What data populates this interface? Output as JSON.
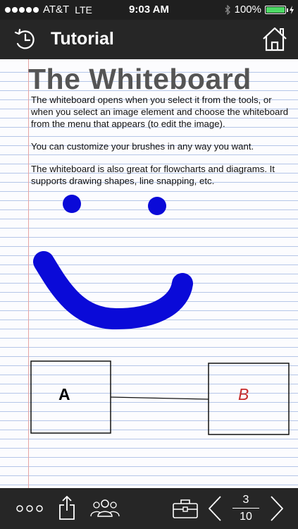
{
  "status_bar": {
    "carrier": "AT&T",
    "network": "LTE",
    "time": "9:03 AM",
    "battery": "100%",
    "battery_level": 1.0,
    "signal_dots": 5
  },
  "nav": {
    "title": "Tutorial",
    "history_icon": "history-icon",
    "home_icon": "home-icon"
  },
  "content": {
    "heading": "The Whiteboard",
    "paragraphs": [
      "The whiteboard opens when you select it from the tools, or when you select an image element and choose the whiteboard from the menu that appears (to edit the image).",
      "You can customize your brushes in any way you want.",
      "The whiteboard is also great for flowcharts and diagrams. It supports drawing shapes, line snapping, etc."
    ],
    "box_a_label": "A",
    "box_b_label": "B"
  },
  "toolbar": {
    "icons": [
      "more-icon",
      "share-icon",
      "collaborators-icon",
      "toolbox-icon",
      "chevron-left-icon",
      "chevron-right-icon"
    ],
    "page_current": "3",
    "page_total": "10"
  },
  "colors": {
    "bar_bg": "#262626",
    "brush": "#0a0ad8",
    "label_b": "#c62c2c",
    "battery_fill": "#4cd964"
  }
}
